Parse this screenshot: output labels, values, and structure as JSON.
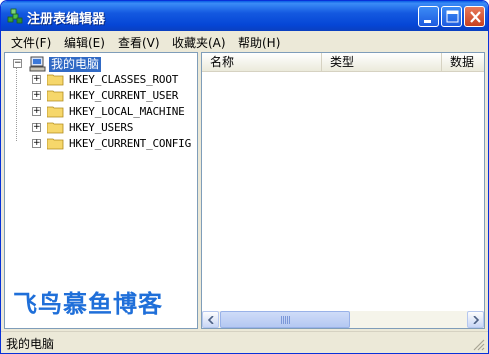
{
  "window": {
    "title": "注册表编辑器"
  },
  "menu": {
    "items": [
      "文件(F)",
      "编辑(E)",
      "查看(V)",
      "收藏夹(A)",
      "帮助(H)"
    ]
  },
  "tree": {
    "root_label": "我的电脑",
    "children": [
      "HKEY_CLASSES_ROOT",
      "HKEY_CURRENT_USER",
      "HKEY_LOCAL_MACHINE",
      "HKEY_USERS",
      "HKEY_CURRENT_CONFIG"
    ],
    "expander_collapsed": "+",
    "expander_expanded": "−"
  },
  "list": {
    "columns": [
      "名称",
      "类型",
      "数据"
    ]
  },
  "watermark": "飞鸟慕鱼博客",
  "status": {
    "text": "我的电脑"
  },
  "colors": {
    "title_bar": "#0546d6",
    "selection": "#316ac5",
    "watermark": "#1f6fd9",
    "chrome": "#ece9d8"
  },
  "icons": {
    "app": "registry-icon",
    "root": "computer-icon",
    "child": "folder-icon"
  }
}
